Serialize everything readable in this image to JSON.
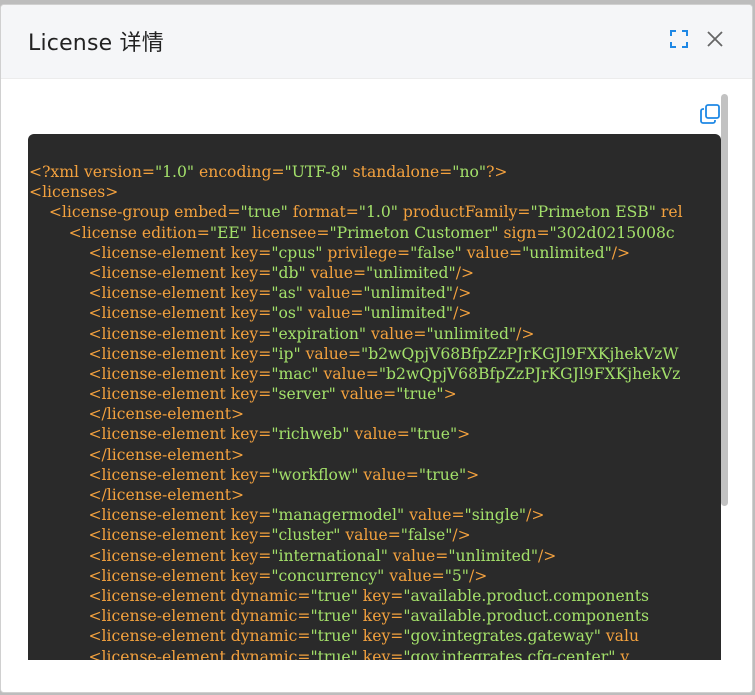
{
  "dialog": {
    "title": "License 详情",
    "maximize_icon": "expand-corners-icon",
    "close_icon": "close-x-icon"
  },
  "toolbar": {
    "copy_icon": "copy-icon"
  },
  "colors": {
    "tag": "#f3a13e",
    "string": "#a3e06a",
    "code_bg": "#2a2a2a",
    "accent": "#1e88e5"
  },
  "code_lines": [
    [
      {
        "t": "tag",
        "v": "<?xml version="
      },
      {
        "t": "str",
        "v": "\"1.0\""
      },
      {
        "t": "tag",
        "v": " encoding="
      },
      {
        "t": "str",
        "v": "\"UTF-8\""
      },
      {
        "t": "tag",
        "v": " standalone="
      },
      {
        "t": "str",
        "v": "\"no\""
      },
      {
        "t": "tag",
        "v": "?>"
      }
    ],
    [
      {
        "t": "tag",
        "v": "<licenses>"
      }
    ],
    [
      {
        "t": "tag",
        "v": "    <license-group embed="
      },
      {
        "t": "str",
        "v": "\"true\""
      },
      {
        "t": "tag",
        "v": " format="
      },
      {
        "t": "str",
        "v": "\"1.0\""
      },
      {
        "t": "tag",
        "v": " productFamily="
      },
      {
        "t": "str",
        "v": "\"Primeton ESB\""
      },
      {
        "t": "tag",
        "v": " rel"
      }
    ],
    [
      {
        "t": "tag",
        "v": "        <license edition="
      },
      {
        "t": "str",
        "v": "\"EE\""
      },
      {
        "t": "tag",
        "v": " licensee="
      },
      {
        "t": "str",
        "v": "\"Primeton Customer\""
      },
      {
        "t": "tag",
        "v": " sign="
      },
      {
        "t": "str",
        "v": "\"302d0215008c"
      }
    ],
    [
      {
        "t": "tag",
        "v": "            <license-element key="
      },
      {
        "t": "str",
        "v": "\"cpus\""
      },
      {
        "t": "tag",
        "v": " privilege="
      },
      {
        "t": "str",
        "v": "\"false\""
      },
      {
        "t": "tag",
        "v": " value="
      },
      {
        "t": "str",
        "v": "\"unlimited\""
      },
      {
        "t": "tag",
        "v": "/>"
      }
    ],
    [
      {
        "t": "tag",
        "v": "            <license-element key="
      },
      {
        "t": "str",
        "v": "\"db\""
      },
      {
        "t": "tag",
        "v": " value="
      },
      {
        "t": "str",
        "v": "\"unlimited\""
      },
      {
        "t": "tag",
        "v": "/>"
      }
    ],
    [
      {
        "t": "tag",
        "v": "            <license-element key="
      },
      {
        "t": "str",
        "v": "\"as\""
      },
      {
        "t": "tag",
        "v": " value="
      },
      {
        "t": "str",
        "v": "\"unlimited\""
      },
      {
        "t": "tag",
        "v": "/>"
      }
    ],
    [
      {
        "t": "tag",
        "v": "            <license-element key="
      },
      {
        "t": "str",
        "v": "\"os\""
      },
      {
        "t": "tag",
        "v": " value="
      },
      {
        "t": "str",
        "v": "\"unlimited\""
      },
      {
        "t": "tag",
        "v": "/>"
      }
    ],
    [
      {
        "t": "tag",
        "v": "            <license-element key="
      },
      {
        "t": "str",
        "v": "\"expiration\""
      },
      {
        "t": "tag",
        "v": " value="
      },
      {
        "t": "str",
        "v": "\"unlimited\""
      },
      {
        "t": "tag",
        "v": "/>"
      }
    ],
    [
      {
        "t": "tag",
        "v": "            <license-element key="
      },
      {
        "t": "str",
        "v": "\"ip\""
      },
      {
        "t": "tag",
        "v": " value="
      },
      {
        "t": "str",
        "v": "\"b2wQpjV68BfpZzPJrKGJl9FXKjhekVzW"
      }
    ],
    [
      {
        "t": "tag",
        "v": "            <license-element key="
      },
      {
        "t": "str",
        "v": "\"mac\""
      },
      {
        "t": "tag",
        "v": " value="
      },
      {
        "t": "str",
        "v": "\"b2wQpjV68BfpZzPJrKGJl9FXKjhekVz"
      }
    ],
    [
      {
        "t": "tag",
        "v": "            <license-element key="
      },
      {
        "t": "str",
        "v": "\"server\""
      },
      {
        "t": "tag",
        "v": " value="
      },
      {
        "t": "str",
        "v": "\"true\""
      },
      {
        "t": "tag",
        "v": ">"
      }
    ],
    [
      {
        "t": "tag",
        "v": "            </license-element>"
      }
    ],
    [
      {
        "t": "tag",
        "v": "            <license-element key="
      },
      {
        "t": "str",
        "v": "\"richweb\""
      },
      {
        "t": "tag",
        "v": " value="
      },
      {
        "t": "str",
        "v": "\"true\""
      },
      {
        "t": "tag",
        "v": ">"
      }
    ],
    [
      {
        "t": "tag",
        "v": "            </license-element>"
      }
    ],
    [
      {
        "t": "tag",
        "v": "            <license-element key="
      },
      {
        "t": "str",
        "v": "\"workflow\""
      },
      {
        "t": "tag",
        "v": " value="
      },
      {
        "t": "str",
        "v": "\"true\""
      },
      {
        "t": "tag",
        "v": ">"
      }
    ],
    [
      {
        "t": "tag",
        "v": "            </license-element>"
      }
    ],
    [
      {
        "t": "tag",
        "v": "            <license-element key="
      },
      {
        "t": "str",
        "v": "\"managermodel\""
      },
      {
        "t": "tag",
        "v": " value="
      },
      {
        "t": "str",
        "v": "\"single\""
      },
      {
        "t": "tag",
        "v": "/>"
      }
    ],
    [
      {
        "t": "tag",
        "v": "            <license-element key="
      },
      {
        "t": "str",
        "v": "\"cluster\""
      },
      {
        "t": "tag",
        "v": " value="
      },
      {
        "t": "str",
        "v": "\"false\""
      },
      {
        "t": "tag",
        "v": "/>"
      }
    ],
    [
      {
        "t": "tag",
        "v": "            <license-element key="
      },
      {
        "t": "str",
        "v": "\"international\""
      },
      {
        "t": "tag",
        "v": " value="
      },
      {
        "t": "str",
        "v": "\"unlimited\""
      },
      {
        "t": "tag",
        "v": "/>"
      }
    ],
    [
      {
        "t": "tag",
        "v": "            <license-element key="
      },
      {
        "t": "str",
        "v": "\"concurrency\""
      },
      {
        "t": "tag",
        "v": " value="
      },
      {
        "t": "str",
        "v": "\"5\""
      },
      {
        "t": "tag",
        "v": "/>"
      }
    ],
    [
      {
        "t": "tag",
        "v": "            <license-element dynamic="
      },
      {
        "t": "str",
        "v": "\"true\""
      },
      {
        "t": "tag",
        "v": " key="
      },
      {
        "t": "str",
        "v": "\"available.product.components"
      }
    ],
    [
      {
        "t": "tag",
        "v": "            <license-element dynamic="
      },
      {
        "t": "str",
        "v": "\"true\""
      },
      {
        "t": "tag",
        "v": " key="
      },
      {
        "t": "str",
        "v": "\"available.product.components"
      }
    ],
    [
      {
        "t": "tag",
        "v": "            <license-element dynamic="
      },
      {
        "t": "str",
        "v": "\"true\""
      },
      {
        "t": "tag",
        "v": " key="
      },
      {
        "t": "str",
        "v": "\"gov.integrates.gateway\""
      },
      {
        "t": "tag",
        "v": " valu"
      }
    ],
    [
      {
        "t": "tag",
        "v": "            <license-element dynamic="
      },
      {
        "t": "str",
        "v": "\"true\""
      },
      {
        "t": "tag",
        "v": " key="
      },
      {
        "t": "str",
        "v": "\"gov.integrates.cfg-center\""
      },
      {
        "t": "tag",
        "v": " v"
      }
    ]
  ]
}
